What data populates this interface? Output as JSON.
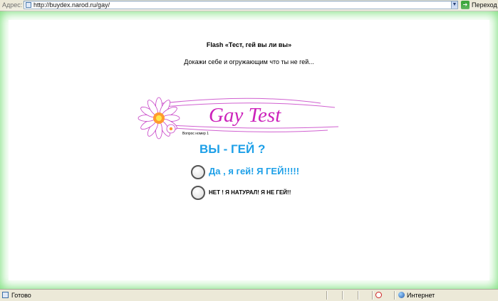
{
  "address_bar": {
    "label": "Адрес:",
    "url": "http://buydex.narod.ru/gay/",
    "dropdown_glyph": "▼",
    "go_icon_glyph": "➔",
    "go_label": "Переход"
  },
  "page": {
    "title": "Flash «Тест, гей вы ли вы»",
    "subtitle": "Докажи себе и огружающим что ты не гей..."
  },
  "flash_quiz": {
    "banner_title": "Gay Test",
    "question_number": "Вопрос номер 1",
    "question": "ВЫ - ГЕЙ ?",
    "answers": [
      {
        "label": "Да , я гей! Я ГЕЙ!!!!!"
      },
      {
        "label": "НЕТ ! Я НАТУРАЛ! Я НЕ ГЕЙ!!"
      }
    ]
  },
  "status_bar": {
    "status_text": "Готово",
    "zone_text": "Интернет"
  },
  "colors": {
    "frame_green": "#7ee07e",
    "banner_pink": "#cc22bb",
    "question_blue": "#1ea0e8"
  },
  "icons": {
    "page": "page-icon",
    "go": "go-arrow-icon",
    "flower": "daisy-flower-icon",
    "popup_blocker": "popup-blocker-icon",
    "zone": "internet-zone-icon"
  }
}
